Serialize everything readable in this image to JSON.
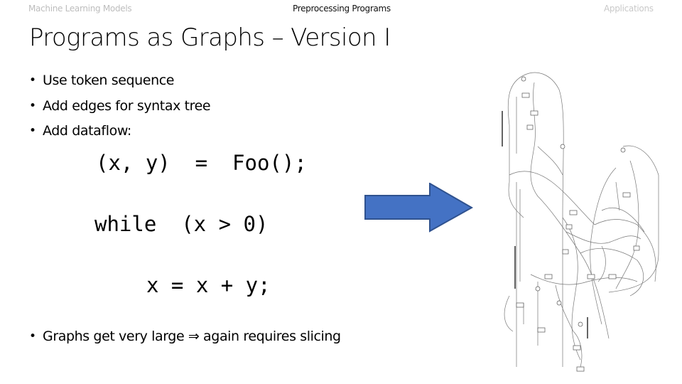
{
  "nav": {
    "left": "Machine Learning Models",
    "center": "Preprocessing Programs",
    "right": "Applications"
  },
  "slide": {
    "title": "Programs as Graphs – Version I",
    "bullets_top": [
      "Use token sequence",
      "Add edges for syntax tree",
      "Add dataflow:"
    ],
    "code_lines": [
      "(x, y)  =  Foo();",
      "while  (x > 0)",
      "x = x + y;"
    ],
    "bullets_bottom": [
      "Graphs get very large ⇒ again requires slicing"
    ],
    "bullet_glyph": "•"
  },
  "arrow": {
    "icon": "right-arrow-icon",
    "fill": "#4472c4",
    "stroke": "#2f528f"
  },
  "graph_image": {
    "icon": "program-graph-image"
  }
}
